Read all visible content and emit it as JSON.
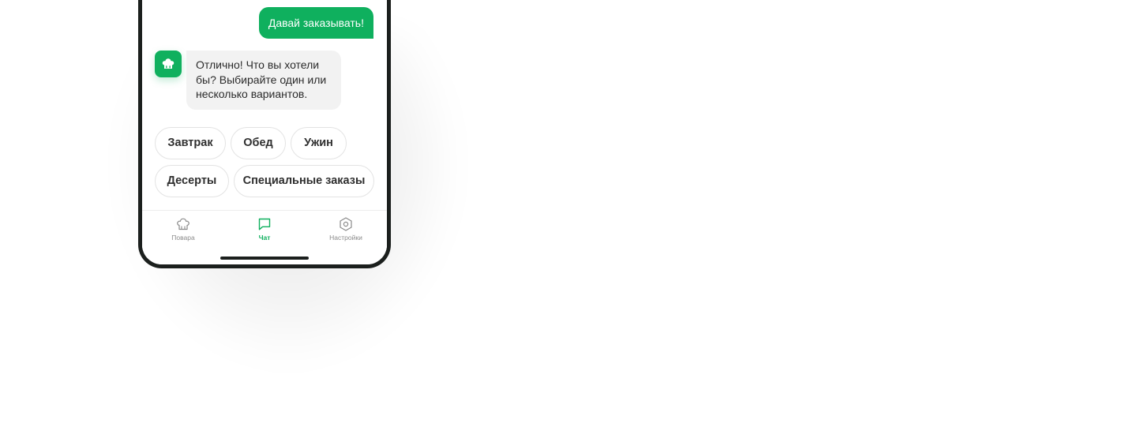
{
  "chat": {
    "user_message": "Давай заказывать!",
    "bot_avatar_icon": "chef-hat-icon",
    "bot_message": "Отлично! Что вы хотели бы? Выбирайте один или несколько вариантов."
  },
  "options": [
    {
      "label": "Завтрак"
    },
    {
      "label": "Обед"
    },
    {
      "label": "Ужин"
    },
    {
      "label": "Десерты"
    },
    {
      "label": "Специальные заказы"
    }
  ],
  "tabbar": {
    "tabs": [
      {
        "label": "Повара",
        "icon": "chef-hat-icon",
        "active": false
      },
      {
        "label": "Чат",
        "icon": "chat-icon",
        "active": true
      },
      {
        "label": "Настройки",
        "icon": "settings-icon",
        "active": false
      }
    ]
  },
  "colors": {
    "accent": "#0fb05e",
    "bubble_gray": "#f2f2f2",
    "frame": "#1b1f1d",
    "inactive_tab": "#8a8a8a"
  }
}
